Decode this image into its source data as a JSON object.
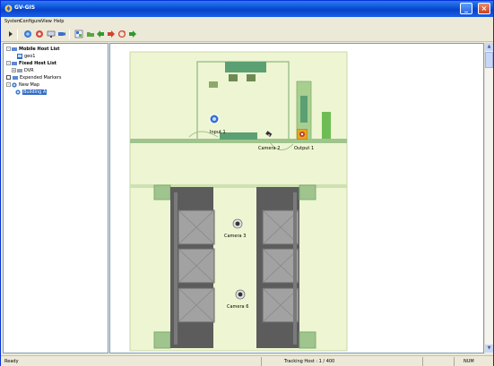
{
  "window": {
    "title": "GV-GIS",
    "minimize": "_",
    "maximize": "□",
    "close": "×"
  },
  "menu": [
    "System",
    "Configure",
    "View",
    "Help"
  ],
  "toolbar": {
    "icons": [
      "play-icon",
      "connect-icon",
      "settings-icon",
      "monitor-icon",
      "camera-icon",
      "map-icon",
      "folder-icon",
      "back-icon",
      "forward-icon",
      "refresh-icon",
      "go-icon"
    ]
  },
  "tree": {
    "mobile_host_list": "Mobile Host List",
    "geo1": "geo1",
    "fixed_host_list": "Fixed Host List",
    "dvr": "DVR",
    "expended_markers": "Expended Markers",
    "new_map": "New Map",
    "building_a": "Building A"
  },
  "map": {
    "markers": {
      "input1": "Input 1",
      "camera2": "Camera 2",
      "output1": "Output 1",
      "camera3": "Camera 3",
      "camera6": "Camera 6"
    },
    "colors": {
      "floor": "#eef5d2",
      "wall": "#9fc48d",
      "furniture": "#5aa072",
      "elevator": "#8a8a8a",
      "frame": "#444444"
    }
  },
  "status": {
    "ready": "Ready",
    "tracking": "Tracking Host : 1 / 400",
    "num": "NUM"
  }
}
